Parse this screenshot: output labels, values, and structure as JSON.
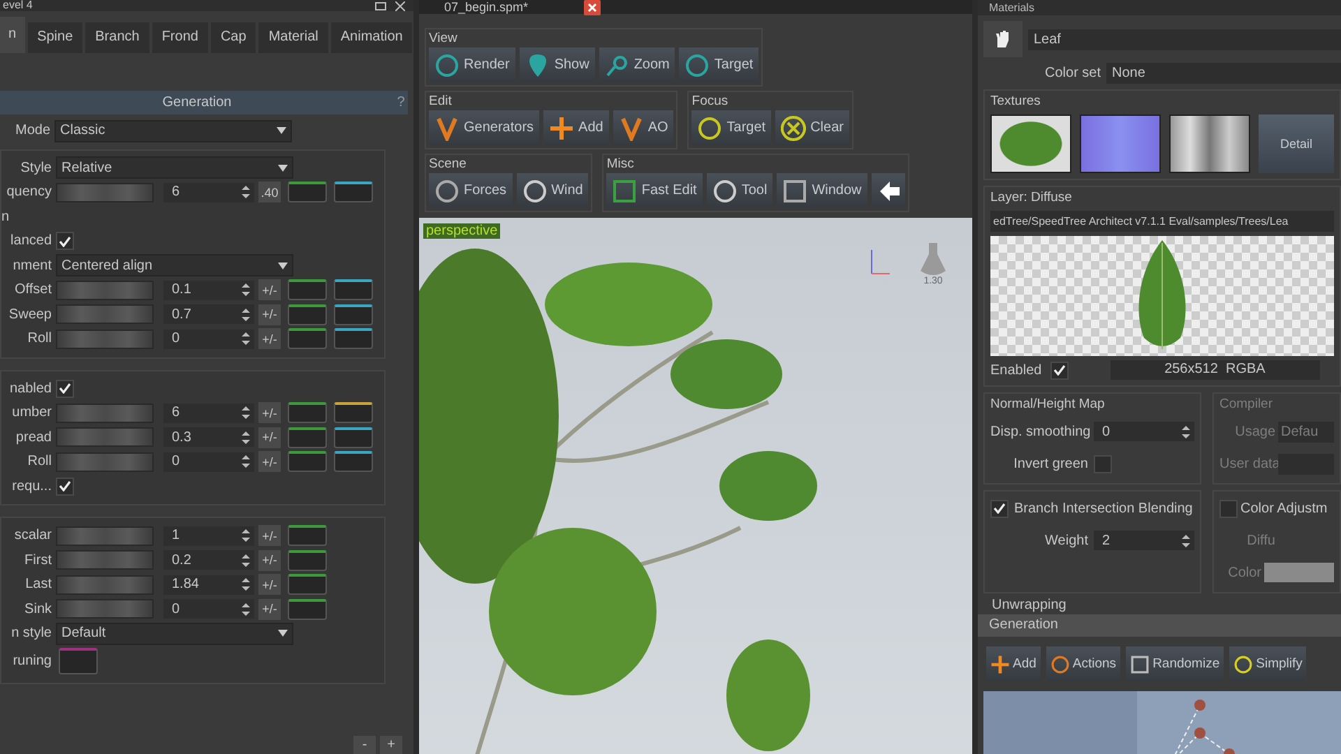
{
  "left_panel": {
    "title": "evel 4",
    "tabs": [
      {
        "label": "n",
        "selected": true
      },
      {
        "label": "Spine",
        "selected": false
      },
      {
        "label": "Branch",
        "selected": false
      },
      {
        "label": "Frond",
        "selected": false
      },
      {
        "label": "Cap",
        "selected": false
      },
      {
        "label": "Material",
        "selected": false
      },
      {
        "label": "Animation",
        "selected": false
      }
    ],
    "section": "Generation",
    "help": "?",
    "mode": {
      "label": "Mode",
      "value": "Classic"
    },
    "groups": [
      {
        "rows": [
          {
            "kind": "dropdown",
            "label": "Style",
            "value": "Relative"
          },
          {
            "kind": "slider",
            "label": "quency",
            "value": "6",
            "button": ".40",
            "curves": [
              {
                "color": "#3c9a3c"
              },
              {
                "color": "#3aa6c0"
              }
            ]
          },
          {
            "kind": "heading",
            "label": "n"
          },
          {
            "kind": "checkbox",
            "label": "lanced",
            "checked": true
          },
          {
            "kind": "dropdown",
            "label": "nment",
            "value": "Centered align"
          },
          {
            "kind": "slider",
            "label": "Offset",
            "value": "0.1",
            "button": "+/-",
            "curves": [
              {
                "color": "#3c9a3c"
              },
              {
                "color": "#3aa6c0"
              }
            ]
          },
          {
            "kind": "slider",
            "label": "Sweep",
            "value": "0.7",
            "button": "+/-",
            "curves": [
              {
                "color": "#3c9a3c"
              },
              {
                "color": "#3aa6c0"
              }
            ]
          },
          {
            "kind": "slider",
            "label": "Roll",
            "value": "0",
            "button": "+/-",
            "curves": [
              {
                "color": "#3c9a3c"
              },
              {
                "color": "#3aa6c0"
              }
            ]
          }
        ]
      },
      {
        "rows": [
          {
            "kind": "checkbox",
            "label": "nabled",
            "checked": true
          },
          {
            "kind": "slider",
            "label": "umber",
            "value": "6",
            "button": "+/-",
            "curves": [
              {
                "color": "#3c9a3c"
              },
              {
                "color": "#c8a23a"
              }
            ]
          },
          {
            "kind": "slider",
            "label": "pread",
            "value": "0.3",
            "button": "+/-",
            "curves": [
              {
                "color": "#3c9a3c"
              },
              {
                "color": "#3aa6c0"
              }
            ]
          },
          {
            "kind": "slider",
            "label": "Roll",
            "value": "0",
            "button": "+/-",
            "curves": [
              {
                "color": "#3c9a3c"
              },
              {
                "color": "#3aa6c0"
              }
            ]
          },
          {
            "kind": "checkbox",
            "label": "requ...",
            "checked": true
          }
        ]
      },
      {
        "rows": [
          {
            "kind": "slider",
            "label": "scalar",
            "value": "1",
            "button": "+/-",
            "curves": [
              {
                "color": "#3c9a3c"
              }
            ]
          },
          {
            "kind": "slider",
            "label": "First",
            "value": "0.2",
            "button": "+/-",
            "curves": [
              {
                "color": "#3c9a3c"
              }
            ]
          },
          {
            "kind": "slider",
            "label": "Last",
            "value": "1.84",
            "button": "+/-",
            "curves": [
              {
                "color": "#3c9a3c"
              }
            ]
          },
          {
            "kind": "slider",
            "label": "Sink",
            "value": "0",
            "button": "+/-",
            "curves": [
              {
                "color": "#3c9a3c"
              }
            ]
          },
          {
            "kind": "dropdown",
            "label": "n style",
            "value": "Default"
          },
          {
            "kind": "color",
            "label": "runing",
            "color": "#a03080"
          }
        ]
      }
    ],
    "buttons": [
      "-",
      "+"
    ]
  },
  "document_tab": {
    "label": "07_begin.spm*"
  },
  "toolbar": [
    [
      {
        "title": "View",
        "buttons": [
          {
            "label": "Render"
          },
          {
            "label": "Show"
          },
          {
            "label": "Zoom"
          },
          {
            "label": "Target"
          }
        ]
      }
    ],
    [
      {
        "title": "Edit",
        "buttons": [
          {
            "label": "Generators"
          },
          {
            "label": "Add"
          },
          {
            "label": "AO"
          }
        ]
      },
      {
        "title": "Focus",
        "buttons": [
          {
            "label": "Target"
          },
          {
            "label": "Clear"
          }
        ]
      }
    ],
    [
      {
        "title": "Scene",
        "buttons": [
          {
            "label": "Forces"
          },
          {
            "label": "Wind"
          }
        ]
      },
      {
        "title": "Misc",
        "buttons": [
          {
            "label": "Fast Edit"
          },
          {
            "label": "Tool"
          },
          {
            "label": "Window"
          }
        ],
        "icon_button": true
      }
    ]
  ],
  "viewport": {
    "camera": "perspective",
    "light_value": "1.30"
  },
  "materials": {
    "title": "Materials",
    "name": "Leaf",
    "color_set_label": "Color set",
    "color_set": "None",
    "textures_title": "Textures",
    "detail_button": "Detail",
    "layer_title": "Layer: Diffuse",
    "path": "edTree/SpeedTree Architect v7.1.1 Eval/samples/Trees/Lea",
    "enabled": {
      "label": "Enabled",
      "checked": true
    },
    "image_info": "256x512  RGBA",
    "normal_map": {
      "title": "Normal/Height Map",
      "smoothing_label": "Disp. smoothing",
      "smoothing": "0",
      "invert": {
        "label": "Invert green",
        "checked": false
      }
    },
    "compiler": {
      "title": "Compiler",
      "usage_label": "Usage",
      "usage": "Defau",
      "user_data_label": "User data"
    },
    "blending": {
      "label": "Branch Intersection Blending",
      "checked": true,
      "weight_label": "Weight",
      "weight": "2"
    },
    "color_adjust": {
      "label": "Color Adjustm",
      "checked": false,
      "diffuse_label": "Diffu",
      "color_label": "Color"
    },
    "unwrapping": "Unwrapping"
  },
  "generation": {
    "title": "Generation",
    "buttons": [
      {
        "label": "Add"
      },
      {
        "label": "Actions"
      },
      {
        "label": "Randomize"
      },
      {
        "label": "Simplify"
      }
    ]
  }
}
